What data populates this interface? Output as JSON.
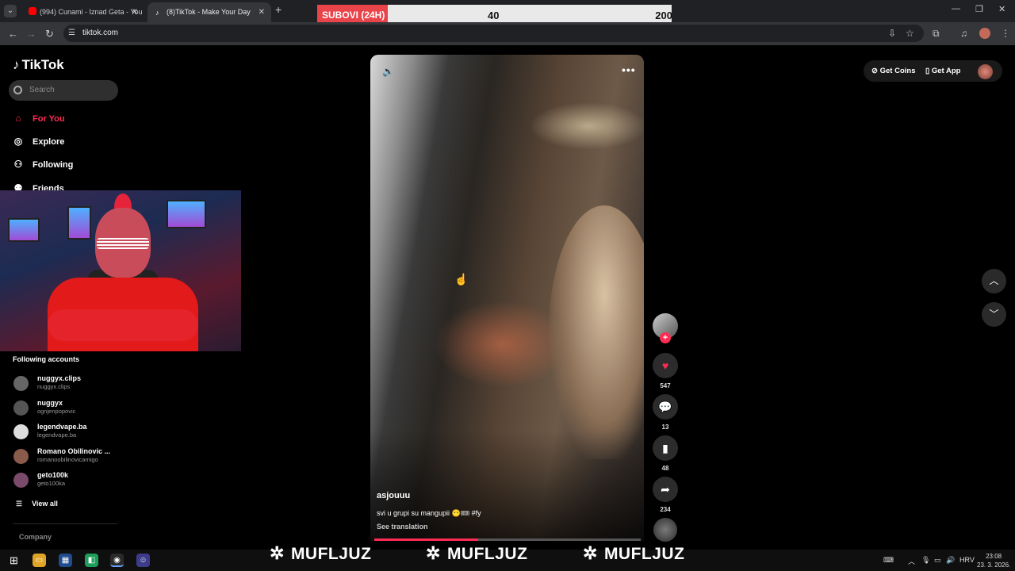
{
  "browser": {
    "tabs": [
      {
        "title": "(994) Cunami - Iznad Geta - You"
      },
      {
        "title": "(8)TikTok - Make Your Day"
      }
    ],
    "url": "tiktok.com"
  },
  "overlay": {
    "sub_label": "SUBOVI (24H)",
    "current": "40",
    "goal": "200"
  },
  "sidebar": {
    "logo": "TikTok",
    "search_placeholder": "Search",
    "nav": [
      {
        "label": "For You",
        "icon": "home-icon"
      },
      {
        "label": "Explore",
        "icon": "compass-icon"
      },
      {
        "label": "Following",
        "icon": "following-icon"
      },
      {
        "label": "Friends",
        "icon": "friends-icon"
      }
    ],
    "following_header": "Following accounts",
    "accounts": [
      {
        "name": "nuggyx.clips",
        "handle": "nuggyx.clips"
      },
      {
        "name": "nuggyx",
        "handle": "ognjenpopovic"
      },
      {
        "name": "legendvape.ba",
        "handle": "legendvape.ba"
      },
      {
        "name": "Romano Obilinovic ...",
        "handle": "romanoobilinovicamigo"
      },
      {
        "name": "geto100k",
        "handle": "geto100ka"
      }
    ],
    "view_all": "View all",
    "company": "Company"
  },
  "video": {
    "author": "asjouuu",
    "caption": "svi u grupi su mangupii 😶🎟 #fy",
    "see_translation": "See translation",
    "progress": 0.39
  },
  "actions": {
    "likes": "547",
    "comments": "13",
    "saves": "48",
    "shares": "234"
  },
  "topright": {
    "get_coins": "Get Coins",
    "get_app": "Get App"
  },
  "watermark": [
    "MUFLJUZ",
    "MUFLJUZ",
    "MUFLJUZ"
  ],
  "taskbar": {
    "lang": "HRV",
    "time": "23:08",
    "date": "23. 3. 2026."
  }
}
